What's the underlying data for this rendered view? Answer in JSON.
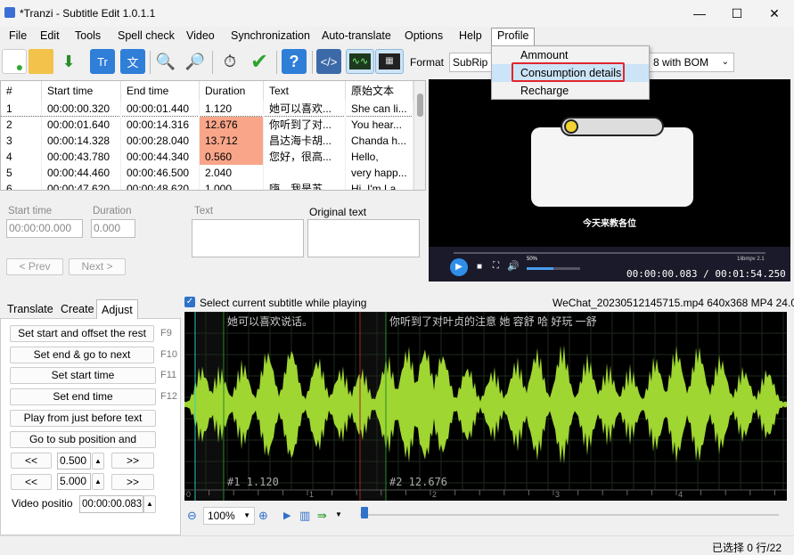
{
  "window": {
    "title": "*Tranzi - Subtitle Edit 1.0.1.1",
    "minimize": "—",
    "maximize": "☐",
    "close": "✕"
  },
  "menu": [
    "File",
    "Edit",
    "Tools",
    "Spell check",
    "Video",
    "Synchronization",
    "Auto-translate",
    "Options",
    "Help",
    "Profile"
  ],
  "profile_menu": [
    "Ammount",
    "Consumption details",
    "Recharge"
  ],
  "toolbar": {
    "format_label": "Format",
    "format_value": "SubRip",
    "encoding_value": "8 with BOM"
  },
  "grid": {
    "headers": [
      "#",
      "Start time",
      "End time",
      "Duration",
      "Text",
      "原始文本"
    ],
    "rows": [
      [
        "1",
        "00:00:00.320",
        "00:00:01.440",
        "1.120",
        "她可以喜欢...",
        "She can li..."
      ],
      [
        "2",
        "00:00:01.640",
        "00:00:14.316",
        "12.676",
        "你听到了对...",
        "You hear..."
      ],
      [
        "3",
        "00:00:14.328",
        "00:00:28.040",
        "13.712",
        "昌达海卡胡...",
        "Chanda h..."
      ],
      [
        "4",
        "00:00:43.780",
        "00:00:44.340",
        "0.560",
        "您好，很高...",
        "Hello,"
      ],
      [
        "5",
        "00:00:44.460",
        "00:00:46.500",
        "2.040",
        "",
        "very happ..."
      ],
      [
        "6",
        "00:00:47.620",
        "00:00:48.620",
        "1.000",
        "嗨，我是苏...",
        "Hi, I'm La..."
      ]
    ]
  },
  "edit": {
    "start_label": "Start time",
    "start_value": "00:00:00.000",
    "duration_label": "Duration",
    "duration_value": "0.000",
    "text_label": "Text",
    "orig_label": "Original text",
    "prev": "< Prev",
    "next": "Next >"
  },
  "video": {
    "caption": "今天来教各位",
    "time": "00:00:00.083 / 00:01:54.250",
    "volume": "50%",
    "rate": "1libmpv 2.1"
  },
  "tabs": [
    "Translate",
    "Create",
    "Adjust"
  ],
  "adjust": {
    "buttons": [
      {
        "label": "Set start and offset the rest",
        "key": "F9"
      },
      {
        "label": "Set end & go to next",
        "key": "F10"
      },
      {
        "label": "Set start time",
        "key": "F11"
      },
      {
        "label": "Set end time",
        "key": "F12"
      },
      {
        "label": "Play from just before text",
        "key": ""
      },
      {
        "label": "Go to sub position and",
        "key": ""
      }
    ],
    "small_back": "<<",
    "small_fwd": ">>",
    "step1": "0.500",
    "step2": "5.000",
    "video_pos_label": "Video positio",
    "video_pos_value": "00:00:00.083"
  },
  "wave": {
    "checkbox_label": "Select current subtitle while playing",
    "file_info": "WeChat_20230512145715.mp4 640x368 MP4 24.0",
    "sub1_text": "她可以喜欢说话。",
    "sub2_text": "你听到了对叶贞的注意 她 容舒 哈 好玩 一舒",
    "sub1_label": "#1  1.120",
    "sub2_label": "#2  12.676",
    "ticks": [
      "0",
      "1",
      "2",
      "3",
      "4"
    ],
    "zoom": "100%"
  },
  "status": "已选择 0 行/22"
}
